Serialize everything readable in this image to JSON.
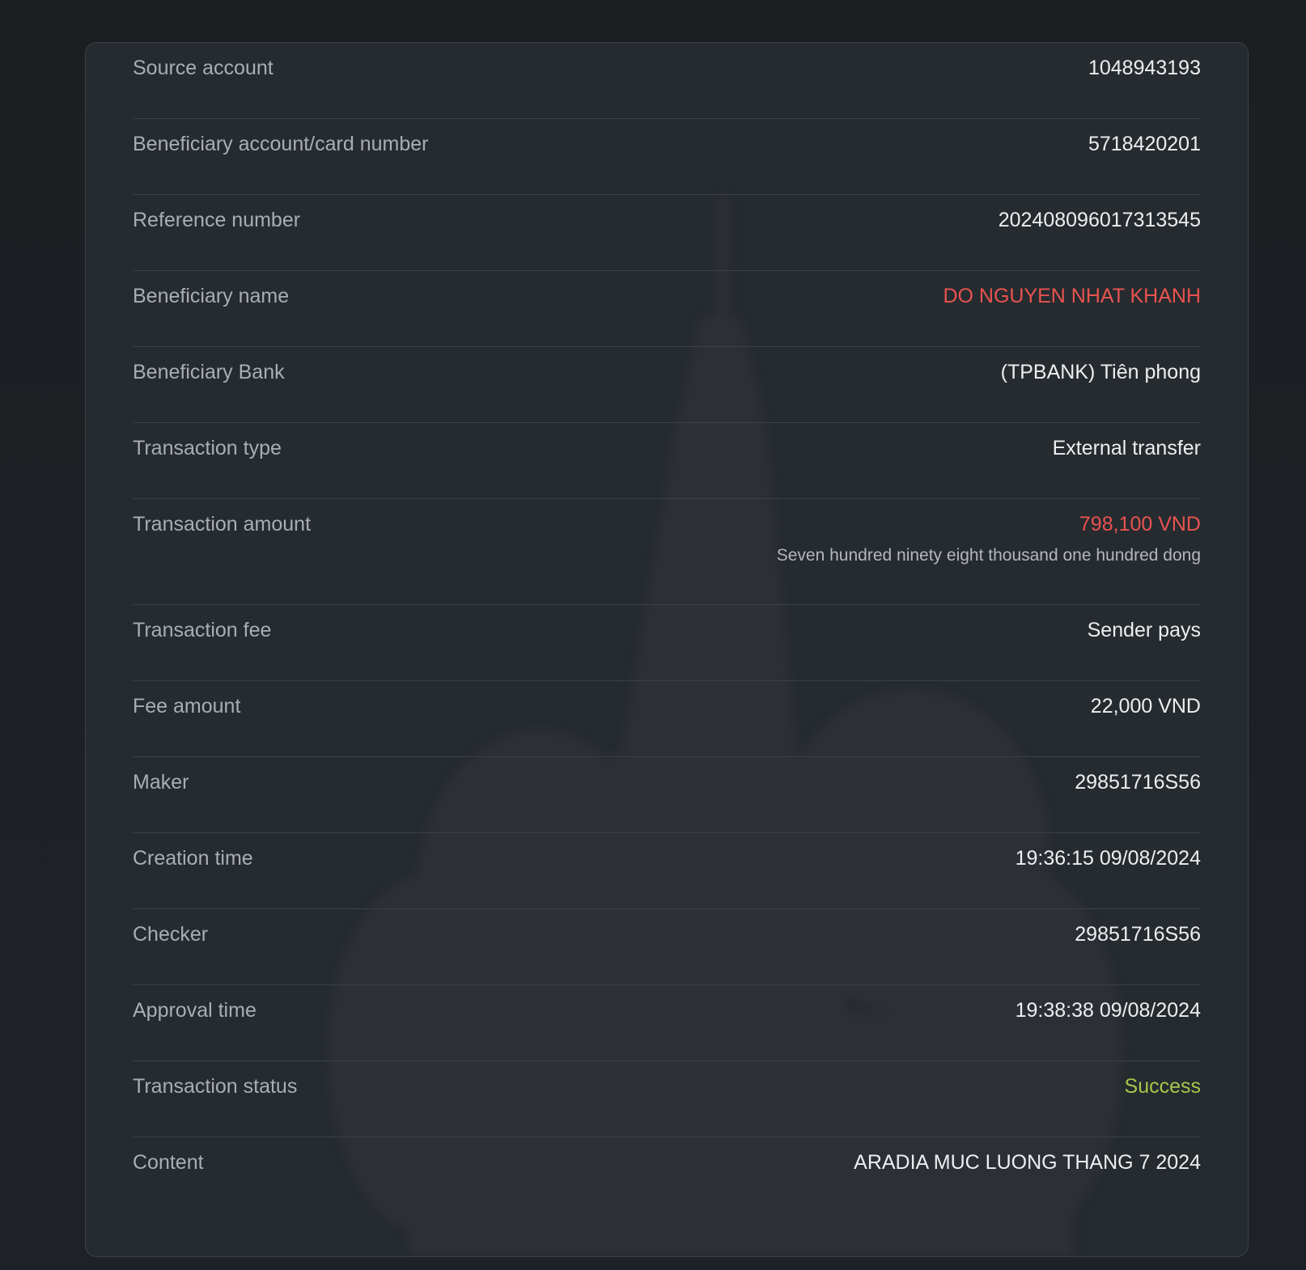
{
  "colors": {
    "background": "#1c2024",
    "card": "#262b30",
    "label": "#a9aeb2",
    "value": "#eceef0",
    "highlight_red": "#e8534f",
    "success_green": "#a9c64a"
  },
  "details": {
    "rows": [
      {
        "label": "Source account",
        "value": "1048943193"
      },
      {
        "label": "Beneficiary account/card number",
        "value": "5718420201"
      },
      {
        "label": "Reference number",
        "value": "202408096017313545"
      },
      {
        "label": "Beneficiary name",
        "value": "DO NGUYEN NHAT KHANH"
      },
      {
        "label": "Beneficiary Bank",
        "value": "(TPBANK) Tiên phong"
      },
      {
        "label": "Transaction type",
        "value": "External transfer"
      },
      {
        "label": "Transaction amount",
        "value": "798,100 VND",
        "sub": "Seven hundred ninety eight thousand one hundred dong"
      },
      {
        "label": "Transaction fee",
        "value": "Sender pays"
      },
      {
        "label": "Fee amount",
        "value": "22,000 VND"
      },
      {
        "label": "Maker",
        "value": "29851716S56"
      },
      {
        "label": "Creation time",
        "value": "19:36:15 09/08/2024"
      },
      {
        "label": "Checker",
        "value": "29851716S56"
      },
      {
        "label": "Approval time",
        "value": "19:38:38 09/08/2024"
      },
      {
        "label": "Transaction status",
        "value": "Success"
      },
      {
        "label": "Content",
        "value": "ARADIA MUC LUONG THANG 7 2024"
      }
    ]
  }
}
